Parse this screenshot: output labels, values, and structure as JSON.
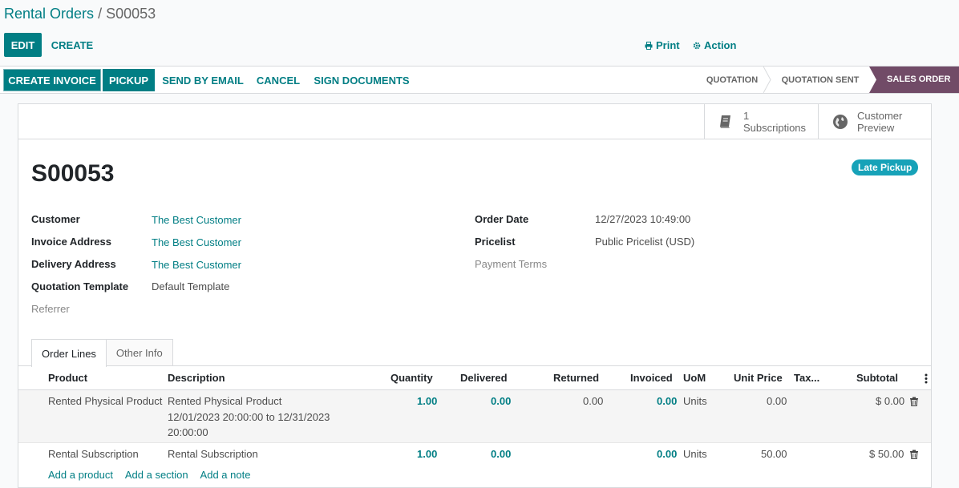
{
  "breadcrumb": {
    "parent": "Rental Orders",
    "separator": "/",
    "current": "S00053"
  },
  "control_panel": {
    "edit_label": "EDIT",
    "create_label": "CREATE",
    "print_label": "Print",
    "action_label": "Action"
  },
  "statusbar": {
    "buttons": {
      "create_invoice": "CREATE INVOICE",
      "pickup": "PICKUP",
      "send_by_email": "SEND BY EMAIL",
      "cancel": "CANCEL",
      "sign_documents": "SIGN DOCUMENTS"
    },
    "stages": [
      "QUOTATION",
      "QUOTATION SENT",
      "SALES ORDER"
    ],
    "active_stage": "SALES ORDER"
  },
  "smart_buttons": {
    "subscriptions_count": "1",
    "subscriptions_label": "Subscriptions",
    "preview_line1": "Customer",
    "preview_line2": "Preview"
  },
  "order": {
    "name": "S00053",
    "badge": "Late Pickup"
  },
  "fields_left": {
    "customer_label": "Customer",
    "customer_value": "The Best Customer",
    "invoice_address_label": "Invoice Address",
    "invoice_address_value": "The Best Customer",
    "delivery_address_label": "Delivery Address",
    "delivery_address_value": "The Best Customer",
    "quotation_template_label": "Quotation Template",
    "quotation_template_value": "Default Template",
    "referrer_label": "Referrer"
  },
  "fields_right": {
    "order_date_label": "Order Date",
    "order_date_value": "12/27/2023 10:49:00",
    "pricelist_label": "Pricelist",
    "pricelist_value": "Public Pricelist (USD)",
    "payment_terms_label": "Payment Terms"
  },
  "tabs": {
    "order_lines": "Order Lines",
    "other_info": "Other Info"
  },
  "table": {
    "headers": {
      "product": "Product",
      "description": "Description",
      "quantity": "Quantity",
      "delivered": "Delivered",
      "returned": "Returned",
      "invoiced": "Invoiced",
      "uom": "UoM",
      "unit_price": "Unit Price",
      "taxes": "Tax...",
      "subtotal": "Subtotal"
    },
    "rows": [
      {
        "product": "Rented Physical Product",
        "description_line1": "Rented Physical Product",
        "description_line2": "12/01/2023 20:00:00 to 12/31/2023",
        "description_line3": "20:00:00",
        "quantity": "1.00",
        "delivered": "0.00",
        "returned": "0.00",
        "invoiced": "0.00",
        "uom": "Units",
        "unit_price": "0.00",
        "subtotal": "$ 0.00"
      },
      {
        "product": "Rental Subscription",
        "description_line1": "Rental Subscription",
        "quantity": "1.00",
        "delivered": "0.00",
        "invoiced": "0.00",
        "uom": "Units",
        "unit_price": "50.00",
        "subtotal": "$ 50.00"
      }
    ],
    "add_links": [
      "Add a product",
      "Add a section",
      "Add a note"
    ]
  }
}
